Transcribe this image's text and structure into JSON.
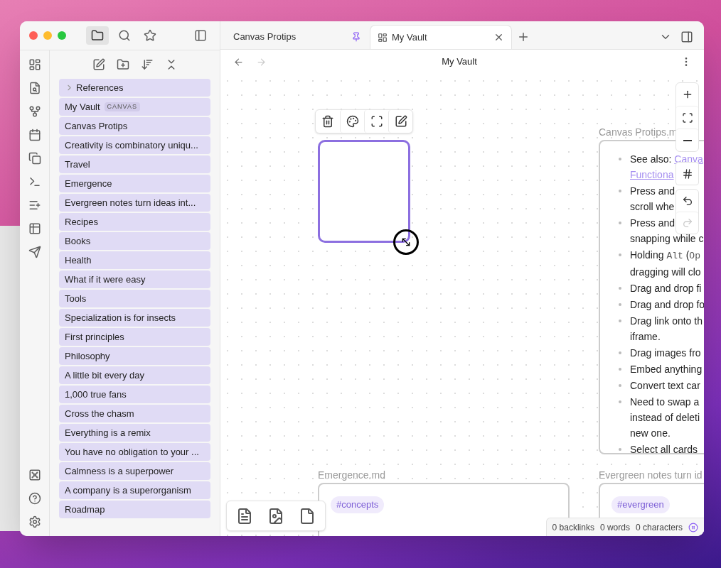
{
  "tabs": [
    {
      "label": "Canvas Protips",
      "kind": "pinned",
      "selected": false
    },
    {
      "label": "My Vault",
      "kind": "canvas",
      "selected": true
    }
  ],
  "sidebar": {
    "items": [
      {
        "label": "References",
        "kind": "folder",
        "selected": true
      },
      {
        "label": "My Vault",
        "badge": "CANVAS",
        "kind": "file",
        "selected": true
      },
      {
        "label": "Canvas Protips",
        "kind": "file",
        "selected": true
      },
      {
        "label": "Creativity is combinatory uniqu...",
        "kind": "file",
        "selected": true
      },
      {
        "label": "Travel",
        "kind": "file",
        "selected": true
      },
      {
        "label": "Emergence",
        "kind": "file",
        "selected": true
      },
      {
        "label": "Evergreen notes turn ideas int...",
        "kind": "file",
        "selected": true
      },
      {
        "label": "Recipes",
        "kind": "file",
        "selected": true
      },
      {
        "label": "Books",
        "kind": "file",
        "selected": true
      },
      {
        "label": "Health",
        "kind": "file",
        "selected": true
      },
      {
        "label": "What if it were easy",
        "kind": "file",
        "selected": true
      },
      {
        "label": "Tools",
        "kind": "file",
        "selected": true
      },
      {
        "label": "Specialization is for insects",
        "kind": "file",
        "selected": true
      },
      {
        "label": "First principles",
        "kind": "file",
        "selected": true
      },
      {
        "label": "Philosophy",
        "kind": "file",
        "selected": true
      },
      {
        "label": "A little bit every day",
        "kind": "file",
        "selected": true
      },
      {
        "label": "1,000 true fans",
        "kind": "file",
        "selected": true
      },
      {
        "label": "Cross the chasm",
        "kind": "file",
        "selected": true
      },
      {
        "label": "Everything is a remix",
        "kind": "file",
        "selected": true
      },
      {
        "label": "You have no obligation to your ...",
        "kind": "file",
        "selected": true
      },
      {
        "label": "Calmness is a superpower",
        "kind": "file",
        "selected": true
      },
      {
        "label": "A company is a superorganism",
        "kind": "file",
        "selected": true
      },
      {
        "label": "Roadmap",
        "kind": "file",
        "selected": true
      }
    ]
  },
  "header": {
    "title": "My Vault",
    "back_disabled": false,
    "forward_disabled": true
  },
  "canvas": {
    "protips": {
      "label": "Canvas Protips.m",
      "bullets": [
        [
          [
            {
              "kind": "text",
              "text": "See also: "
            },
            {
              "kind": "link",
              "text": "Canva"
            }
          ],
          [
            {
              "kind": "link",
              "text": "Functiona"
            }
          ]
        ],
        [
          [
            {
              "kind": "text",
              "text": "Press and"
            }
          ],
          [
            {
              "kind": "text",
              "text": "scroll whe"
            }
          ]
        ],
        [
          [
            {
              "kind": "text",
              "text": "Press and"
            }
          ],
          [
            {
              "kind": "text",
              "text": "snapping while c"
            }
          ]
        ],
        [
          [
            {
              "kind": "text",
              "text": "Holding "
            },
            {
              "kind": "code",
              "text": "Alt"
            },
            {
              "kind": "text",
              "text": " ("
            },
            {
              "kind": "code",
              "text": "Op"
            }
          ],
          [
            {
              "kind": "text",
              "text": "dragging will clo"
            }
          ]
        ],
        [
          [
            {
              "kind": "text",
              "text": "Drag and drop fi"
            }
          ]
        ],
        [
          [
            {
              "kind": "text",
              "text": "Drag and drop fo"
            }
          ]
        ],
        [
          [
            {
              "kind": "text",
              "text": "Drag link onto th"
            }
          ],
          [
            {
              "kind": "text",
              "text": "iframe."
            }
          ]
        ],
        [
          [
            {
              "kind": "text",
              "text": "Drag images fro"
            }
          ]
        ],
        [
          [
            {
              "kind": "text",
              "text": "Embed anything"
            }
          ]
        ],
        [
          [
            {
              "kind": "text",
              "text": "Convert text car"
            }
          ]
        ],
        [
          [
            {
              "kind": "text",
              "text": "Need to swap a"
            }
          ],
          [
            {
              "kind": "text",
              "text": "instead of deleti"
            }
          ],
          [
            {
              "kind": "text",
              "text": "new one."
            }
          ]
        ],
        [
          [
            {
              "kind": "text",
              "text": "Select all cards"
            }
          ]
        ]
      ]
    },
    "emergence": {
      "label": "Emergence.md",
      "tag": "#concepts"
    },
    "evergreen": {
      "label": "Evergreen notes turn id",
      "tag": "#evergreen"
    },
    "redo_disabled": true
  },
  "status_bar": [
    "0 backlinks",
    "0 words",
    "0 characters"
  ]
}
